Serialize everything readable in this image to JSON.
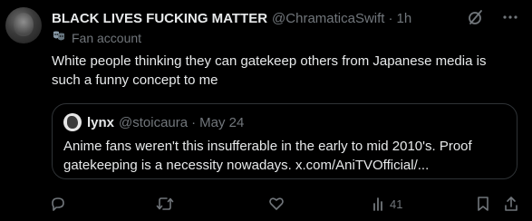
{
  "tweet": {
    "display_name": "BLACK LIVES FUCKING MATTER",
    "handle": "@ChramaticaSwift",
    "separator": "·",
    "time": "1h",
    "label": "Fan account",
    "label_icon": "masks-icon",
    "text": "White people thinking they can gatekeep others from Japanese media is such a funny concept to me"
  },
  "quote": {
    "display_name": "lynx",
    "handle": "@stoicaura",
    "separator": "·",
    "time": "May 24",
    "text": "Anime fans weren't this insufferable in the early to mid 2010's. Proof gatekeeping is a necessity nowadays. x.com/AniTVOfficial/..."
  },
  "actions": {
    "reply_icon": "reply-icon",
    "retweet_icon": "retweet-icon",
    "like_icon": "like-icon",
    "views_icon": "views-icon",
    "views_count": "41",
    "bookmark_icon": "bookmark-icon",
    "share_icon": "share-icon"
  },
  "colors": {
    "background": "#000000",
    "text_primary": "#e7e9ea",
    "text_secondary": "#71767b",
    "border": "#2f3336"
  }
}
